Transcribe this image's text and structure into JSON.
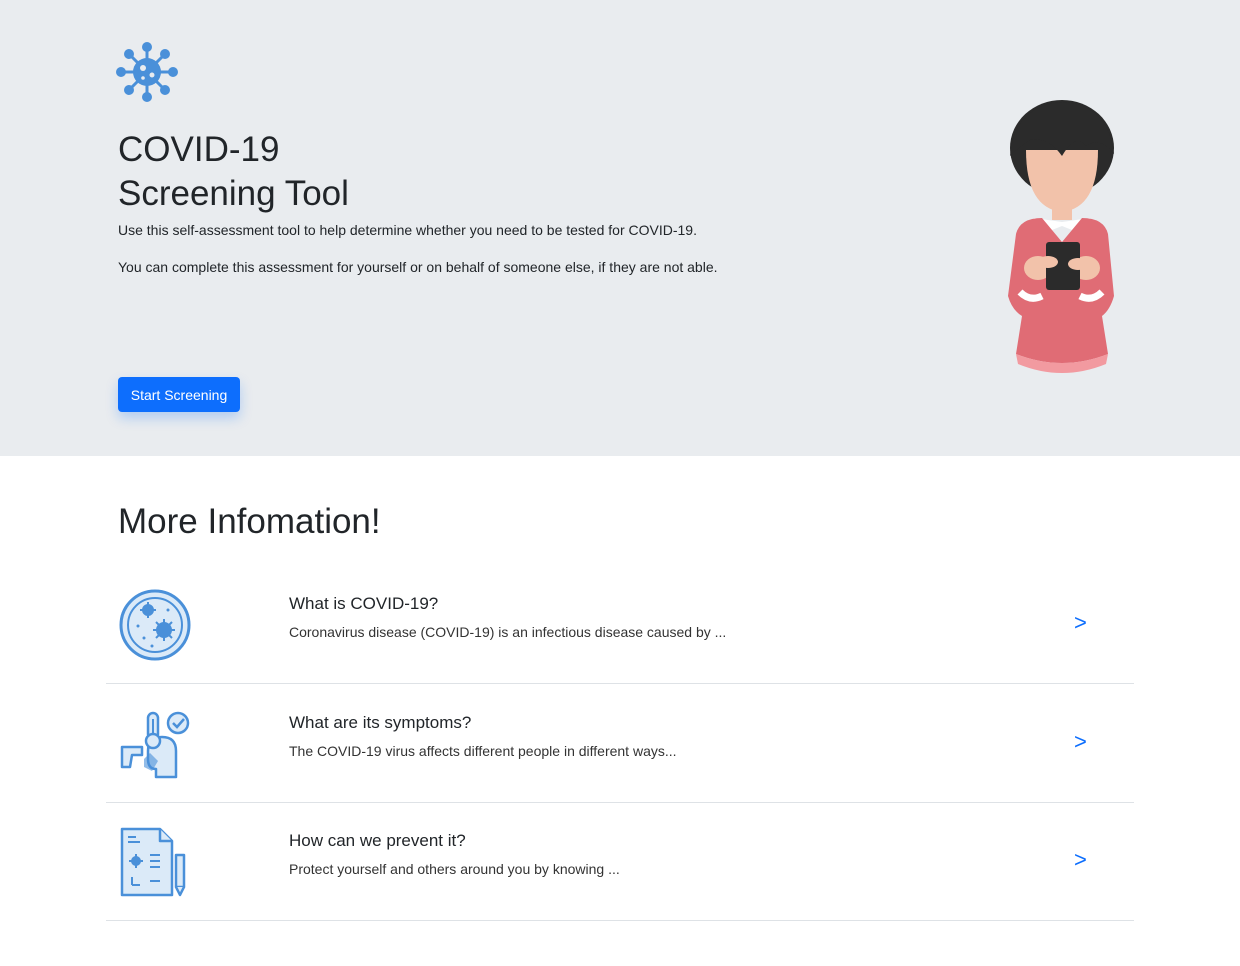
{
  "hero": {
    "title_line1": "COVID-19",
    "title_line2": "Screening Tool",
    "description1": "Use this self-assessment tool to help determine whether you need to be tested for COVID-19.",
    "description2": "You can complete this assessment for yourself or on behalf of someone else, if they are not able.",
    "start_button": "Start Screening"
  },
  "info": {
    "heading": "More Infomation!",
    "items": [
      {
        "title": "What is COVID-19?",
        "description": "Coronavirus disease (COVID-19) is an infectious disease caused by ...",
        "arrow": ">",
        "icon": "virus-petri-dish-icon"
      },
      {
        "title": "What are its symptoms?",
        "description": "The COVID-19 virus affects different people in different ways...",
        "arrow": ">",
        "icon": "thermometer-symptoms-icon"
      },
      {
        "title": "How can we prevent it?",
        "description": "Protect yourself and others around you by knowing ...",
        "arrow": ">",
        "icon": "document-pencil-icon"
      }
    ]
  },
  "colors": {
    "hero_background": "#e9ecef",
    "primary": "#0d6efd",
    "icon_blue": "#4a90d9",
    "sweater": "#e06c75"
  }
}
